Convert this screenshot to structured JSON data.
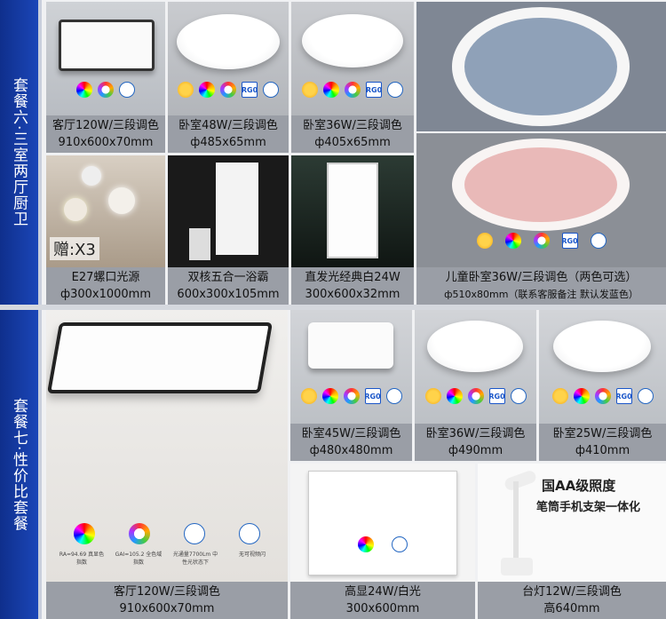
{
  "sections": [
    {
      "label": "套餐六·三室两厅厨卫"
    },
    {
      "label": "套餐七·性价比套餐"
    }
  ],
  "set6": {
    "items": [
      {
        "line1": "客厅120W/三段调色",
        "line2": "910x600x70mm"
      },
      {
        "line1": "卧室48W/三段调色",
        "line2": "ф485x65mm"
      },
      {
        "line1": "卧室36W/三段调色",
        "line2": "ф405x65mm"
      },
      {
        "line1": "E27螺口光源",
        "line2": "ф300x1000mm"
      },
      {
        "line1": "双核五合一浴霸",
        "line2": "600x300x105mm"
      },
      {
        "line1": "直发光经典白24W",
        "line2": "300x600x32mm"
      },
      {
        "line1": "儿童卧室36W/三段调色（两色可选）",
        "line2": "ф510x80mm（联系客服备注 默认发蓝色）"
      }
    ],
    "gift_text": "赠:X3"
  },
  "set7": {
    "items": [
      {
        "line1": "卧室45W/三段调色",
        "line2": "ф480x480mm"
      },
      {
        "line1": "卧室36W/三段调色",
        "line2": "ф490mm"
      },
      {
        "line1": "卧室25W/三段调色",
        "line2": "ф410mm"
      },
      {
        "line1": "客厅120W/三段调色",
        "line2": "910x600x70mm"
      },
      {
        "line1": "高显24W/白光",
        "line2": "300x600mm"
      },
      {
        "line1": "台灯12W/三段调色",
        "line2": "高640mm"
      }
    ],
    "desk_lamp_ad": {
      "title": "国AA级照度",
      "subtitle": "笔筒手机支架一体化"
    },
    "living_icons": [
      {
        "label": "RA=94.69 真显色指数"
      },
      {
        "label": "GAI=105.2 全色域指数"
      },
      {
        "label": "光通量7700Lm 中性光状态下"
      },
      {
        "label": "无可视频闪"
      }
    ]
  },
  "colors": {
    "sidebar": "#1535a0",
    "caption_bg": "#9a9ea6"
  }
}
